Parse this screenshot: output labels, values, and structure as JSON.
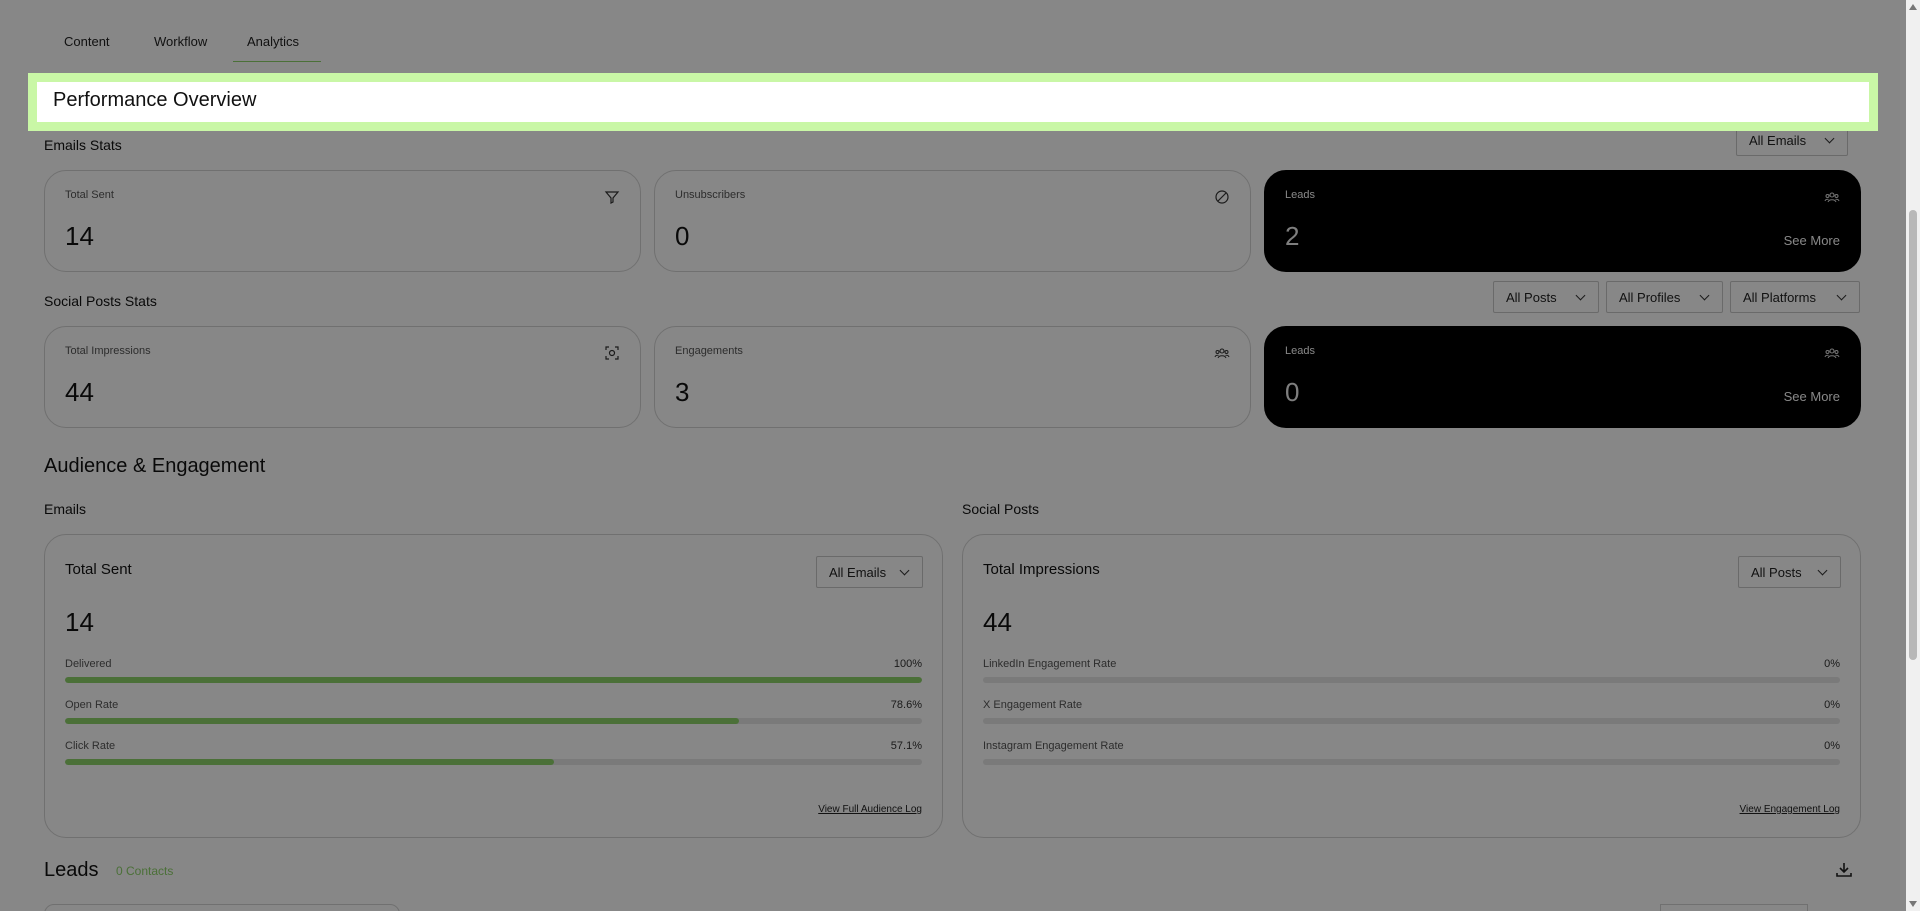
{
  "tabs": [
    {
      "label": "Content"
    },
    {
      "label": "Workflow"
    },
    {
      "label": "Analytics"
    }
  ],
  "highlight": {
    "title": "Performance Overview"
  },
  "emails_stats": {
    "title": "Emails Stats",
    "filter": "All Emails",
    "cards": [
      {
        "label": "Total Sent",
        "value": "14",
        "icon": "filter-icon"
      },
      {
        "label": "Unsubscribers",
        "value": "0",
        "icon": "block-icon"
      },
      {
        "label": "Leads",
        "value": "2",
        "icon": "people-icon",
        "see_more": "See More"
      }
    ]
  },
  "social_stats": {
    "title": "Social Posts Stats",
    "filters": [
      "All Posts",
      "All Profiles",
      "All Platforms"
    ],
    "cards": [
      {
        "label": "Total Impressions",
        "value": "44",
        "icon": "focus-icon"
      },
      {
        "label": "Engagements",
        "value": "3",
        "icon": "people-icon"
      },
      {
        "label": "Leads",
        "value": "0",
        "icon": "people-icon",
        "see_more": "See More"
      }
    ]
  },
  "audience": {
    "title": "Audience & Engagement",
    "emails": {
      "heading": "Emails",
      "panel_title": "Total Sent",
      "filter": "All Emails",
      "value": "14",
      "metrics": [
        {
          "label": "Delivered",
          "value": "100%",
          "fill": 100
        },
        {
          "label": "Open Rate",
          "value": "78.6%",
          "fill": 78.6
        },
        {
          "label": "Click Rate",
          "value": "57.1%",
          "fill": 57.1
        }
      ],
      "link": "View Full Audience Log"
    },
    "social": {
      "heading": "Social Posts",
      "panel_title": "Total Impressions",
      "filter": "All Posts",
      "value": "44",
      "metrics": [
        {
          "label": "LinkedIn Engagement Rate",
          "value": "0%",
          "fill": 0
        },
        {
          "label": "X Engagement Rate",
          "value": "0%",
          "fill": 0
        },
        {
          "label": "Instagram Engagement Rate",
          "value": "0%",
          "fill": 0
        }
      ],
      "link": "View Engagement Log"
    }
  },
  "leads": {
    "title": "Leads",
    "contacts": "0 Contacts"
  },
  "colors": {
    "accent": "#8fd36b",
    "highlight": "#c9f7a6",
    "dark_card": "#000000"
  }
}
